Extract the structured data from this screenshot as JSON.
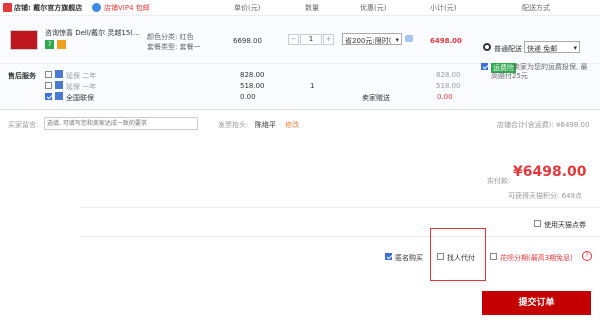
{
  "header": {
    "store_label": "店铺: 戴尔官方旗舰店",
    "vip_label": "店铺VIP4 包邮",
    "cols": [
      "单价(元)",
      "数量",
      "优惠(元)",
      "小计(元)",
      "配送方式"
    ]
  },
  "product": {
    "title": "咨询惊喜 Dell/戴尔 灵越15(...",
    "attr_color": "颜色分类: 红色",
    "attr_pkg": "套餐类型: 套餐一",
    "price": "6698.00",
    "qty": "1",
    "discount_select": "省200元:限时(",
    "subtotal": "6498.00",
    "badge1": "7",
    "shipping_label": "普通配送",
    "shipping_select": "快递 免邮"
  },
  "service": {
    "label": "售后服务",
    "items": [
      {
        "name": "延保 二年",
        "price": "828.00",
        "qty": "",
        "subtotal": "828.00"
      },
      {
        "name": "延保 一年",
        "price": "518.00",
        "qty": "1",
        "subtotal": "518.00"
      },
      {
        "name": "全国联保",
        "price": "0.00",
        "qty": "",
        "subtotal": "0.00"
      }
    ],
    "free_seller": "卖家赠送",
    "insurance_tag": "运费险",
    "insurance_text": "卖家为您的运费投保, 最高赔付25元"
  },
  "message": {
    "label": "买家留言:",
    "placeholder": "选填, 可填写您和卖家达成一致的要求",
    "invoice_label": "发票抬头:",
    "invoice_name": "陈络平",
    "edit": "修改",
    "store_total": "店铺合计(含运费): ¥6498.00"
  },
  "summary": {
    "paid_label": "实付款:",
    "paid_amount": "¥6498.00",
    "points": "可获得天猫积分: 649点",
    "tmall_coupon": "使用天猫点券",
    "anonymous": "匿名购买",
    "proxy": "找人代付",
    "installment": "花呗分期(最高3期免息)",
    "help_icon": "?",
    "submit": "提交订单"
  },
  "colors": {
    "red": "#e4393c",
    "submit_bg": "#c40000",
    "blue": "#3d6fd8"
  }
}
